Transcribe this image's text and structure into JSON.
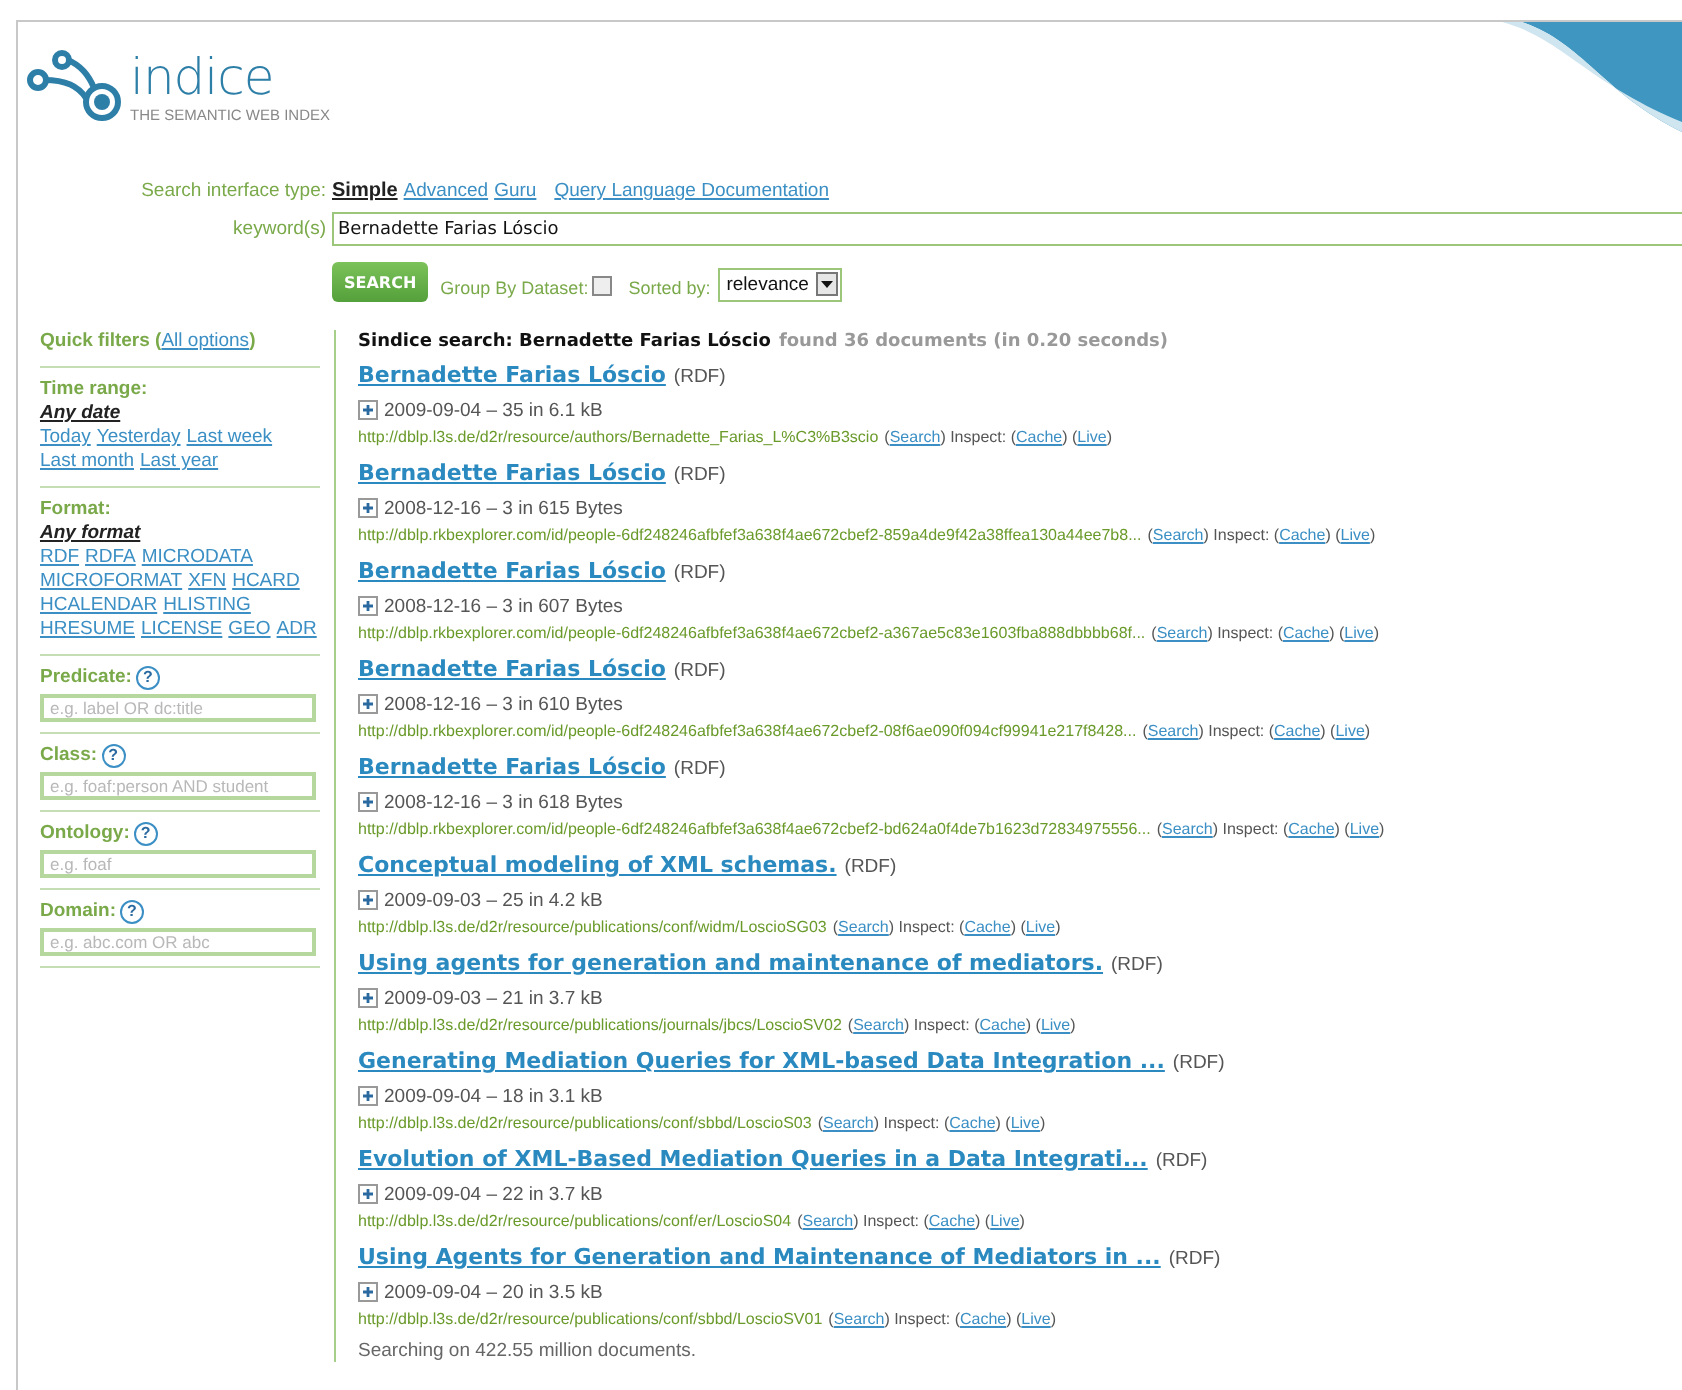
{
  "logo": {
    "name": "indice",
    "tagline": "THE SEMANTIC WEB INDEX"
  },
  "search": {
    "type_label": "Search interface type:",
    "types": [
      {
        "label": "Simple",
        "selected": true
      },
      {
        "label": "Advanced",
        "selected": false
      },
      {
        "label": "Guru",
        "selected": false
      }
    ],
    "doc_link": "Query Language Documentation",
    "keyword_label": "keyword(s)",
    "keyword": "Bernadette Farias Lóscio",
    "button": "SEARCH",
    "group_label": "Group By Dataset:",
    "group_checked": false,
    "sorted_label": "Sorted by:",
    "sort_value": "relevance"
  },
  "sidebar": {
    "title": "Quick filters (",
    "all_options": "All options",
    "title_end": ")",
    "option_groups": [
      {
        "label": "Time range:",
        "options": [
          {
            "label": "Any date",
            "selected": true
          },
          {
            "label": "Today",
            "selected": false
          },
          {
            "label": "Yesterday",
            "selected": false
          },
          {
            "label": "Last week",
            "selected": false
          },
          {
            "label": "Last month",
            "selected": false
          },
          {
            "label": "Last year",
            "selected": false
          }
        ]
      },
      {
        "label": "Format:",
        "options": [
          {
            "label": "Any format",
            "selected": true
          },
          {
            "label": "RDF",
            "selected": false
          },
          {
            "label": "RDFA",
            "selected": false
          },
          {
            "label": "MICRODATA",
            "selected": false
          },
          {
            "label": "MICROFORMAT",
            "selected": false
          },
          {
            "label": "XFN",
            "selected": false
          },
          {
            "label": "HCARD",
            "selected": false
          },
          {
            "label": "HCALENDAR",
            "selected": false
          },
          {
            "label": "HLISTING",
            "selected": false
          },
          {
            "label": "HRESUME",
            "selected": false
          },
          {
            "label": "LICENSE",
            "selected": false
          },
          {
            "label": "GEO",
            "selected": false
          },
          {
            "label": "ADR",
            "selected": false
          }
        ]
      }
    ],
    "fields": [
      {
        "label": "Predicate:",
        "help": "?",
        "placeholder": "e.g. label OR dc:title"
      },
      {
        "label": "Class:",
        "help": "?",
        "placeholder": "e.g. foaf:person AND student"
      },
      {
        "label": "Ontology:",
        "help": "?",
        "placeholder": "e.g. foaf"
      },
      {
        "label": "Domain:",
        "help": "?",
        "placeholder": "e.g. abc.com OR abc"
      }
    ]
  },
  "summary": {
    "query": "Sindice search: Bernadette Farias Lóscio",
    "found": "found 36 documents (in 0.20 seconds)"
  },
  "results": [
    {
      "title": "Bernadette Farias Lóscio",
      "format": "(RDF)",
      "meta": "2009-09-04 – 35 in 6.1 kB",
      "url": "http://dblp.l3s.de/d2r/resource/authors/Bernadette_Farias_L%C3%B3scio",
      "parts": [
        {
          "kind": "text",
          "text": "("
        },
        {
          "kind": "link",
          "text": "Search"
        },
        {
          "kind": "text",
          "text": ") Inspect: ("
        },
        {
          "kind": "link",
          "text": "Cache"
        },
        {
          "kind": "text",
          "text": ") ("
        },
        {
          "kind": "link",
          "text": "Live"
        },
        {
          "kind": "text",
          "text": ")"
        }
      ]
    },
    {
      "title": "Bernadette Farias Lóscio",
      "format": "(RDF)",
      "meta": "2008-12-16 – 3 in 615 Bytes",
      "url": "http://dblp.rkbexplorer.com/id/people-6df248246afbfef3a638f4ae672cbef2-859a4de9f42a38ffea130a44ee7b8...",
      "parts": [
        {
          "kind": "text",
          "text": "("
        },
        {
          "kind": "link",
          "text": "Search"
        },
        {
          "kind": "text",
          "text": ") Inspect: ("
        },
        {
          "kind": "link",
          "text": "Cache"
        },
        {
          "kind": "text",
          "text": ") ("
        },
        {
          "kind": "link",
          "text": "Live"
        },
        {
          "kind": "text",
          "text": ")"
        }
      ]
    },
    {
      "title": "Bernadette Farias Lóscio",
      "format": "(RDF)",
      "meta": "2008-12-16 – 3 in 607 Bytes",
      "url": "http://dblp.rkbexplorer.com/id/people-6df248246afbfef3a638f4ae672cbef2-a367ae5c83e1603fba888dbbbb68f...",
      "parts": [
        {
          "kind": "text",
          "text": "("
        },
        {
          "kind": "link",
          "text": "Search"
        },
        {
          "kind": "text",
          "text": ") Inspect: ("
        },
        {
          "kind": "link",
          "text": "Cache"
        },
        {
          "kind": "text",
          "text": ") ("
        },
        {
          "kind": "link",
          "text": "Live"
        },
        {
          "kind": "text",
          "text": ")"
        }
      ]
    },
    {
      "title": "Bernadette Farias Lóscio",
      "format": "(RDF)",
      "meta": "2008-12-16 – 3 in 610 Bytes",
      "url": "http://dblp.rkbexplorer.com/id/people-6df248246afbfef3a638f4ae672cbef2-08f6ae090f094cf99941e217f8428...",
      "parts": [
        {
          "kind": "text",
          "text": "("
        },
        {
          "kind": "link",
          "text": "Search"
        },
        {
          "kind": "text",
          "text": ") Inspect: ("
        },
        {
          "kind": "link",
          "text": "Cache"
        },
        {
          "kind": "text",
          "text": ") ("
        },
        {
          "kind": "link",
          "text": "Live"
        },
        {
          "kind": "text",
          "text": ")"
        }
      ]
    },
    {
      "title": "Bernadette Farias Lóscio",
      "format": "(RDF)",
      "meta": "2008-12-16 – 3 in 618 Bytes",
      "url": "http://dblp.rkbexplorer.com/id/people-6df248246afbfef3a638f4ae672cbef2-bd624a0f4de7b1623d72834975556...",
      "parts": [
        {
          "kind": "text",
          "text": "("
        },
        {
          "kind": "link",
          "text": "Search"
        },
        {
          "kind": "text",
          "text": ") Inspect: ("
        },
        {
          "kind": "link",
          "text": "Cache"
        },
        {
          "kind": "text",
          "text": ") ("
        },
        {
          "kind": "link",
          "text": "Live"
        },
        {
          "kind": "text",
          "text": ")"
        }
      ]
    },
    {
      "title": "Conceptual modeling of XML schemas.",
      "format": "(RDF)",
      "meta": "2009-09-03 – 25 in 4.2 kB",
      "url": "http://dblp.l3s.de/d2r/resource/publications/conf/widm/LoscioSG03",
      "parts": [
        {
          "kind": "text",
          "text": "("
        },
        {
          "kind": "link",
          "text": "Search"
        },
        {
          "kind": "text",
          "text": ") Inspect: ("
        },
        {
          "kind": "link",
          "text": "Cache"
        },
        {
          "kind": "text",
          "text": ") ("
        },
        {
          "kind": "link",
          "text": "Live"
        },
        {
          "kind": "text",
          "text": ")"
        }
      ]
    },
    {
      "title": "Using agents for generation and maintenance of mediators.",
      "format": "(RDF)",
      "meta": "2009-09-03 – 21 in 3.7 kB",
      "url": "http://dblp.l3s.de/d2r/resource/publications/journals/jbcs/LoscioSV02",
      "parts": [
        {
          "kind": "text",
          "text": "("
        },
        {
          "kind": "link",
          "text": "Search"
        },
        {
          "kind": "text",
          "text": ") Inspect: ("
        },
        {
          "kind": "link",
          "text": "Cache"
        },
        {
          "kind": "text",
          "text": ") ("
        },
        {
          "kind": "link",
          "text": "Live"
        },
        {
          "kind": "text",
          "text": ")"
        }
      ]
    },
    {
      "title": "Generating Mediation Queries for XML-based Data Integration ...",
      "format": "(RDF)",
      "meta": "2009-09-04 – 18 in 3.1 kB",
      "url": "http://dblp.l3s.de/d2r/resource/publications/conf/sbbd/LoscioS03",
      "parts": [
        {
          "kind": "text",
          "text": "("
        },
        {
          "kind": "link",
          "text": "Search"
        },
        {
          "kind": "text",
          "text": ") Inspect: ("
        },
        {
          "kind": "link",
          "text": "Cache"
        },
        {
          "kind": "text",
          "text": ") ("
        },
        {
          "kind": "link",
          "text": "Live"
        },
        {
          "kind": "text",
          "text": ")"
        }
      ]
    },
    {
      "title": "Evolution of XML-Based Mediation Queries in a Data Integrati...",
      "format": "(RDF)",
      "meta": "2009-09-04 – 22 in 3.7 kB",
      "url": "http://dblp.l3s.de/d2r/resource/publications/conf/er/LoscioS04",
      "parts": [
        {
          "kind": "text",
          "text": "("
        },
        {
          "kind": "link",
          "text": "Search"
        },
        {
          "kind": "text",
          "text": ") Inspect: ("
        },
        {
          "kind": "link",
          "text": "Cache"
        },
        {
          "kind": "text",
          "text": ") ("
        },
        {
          "kind": "link",
          "text": "Live"
        },
        {
          "kind": "text",
          "text": ")"
        }
      ]
    },
    {
      "title": "Using Agents for Generation and Maintenance of Mediators in ...",
      "format": "(RDF)",
      "meta": "2009-09-04 – 20 in 3.5 kB",
      "url": "http://dblp.l3s.de/d2r/resource/publications/conf/sbbd/LoscioSV01",
      "parts": [
        {
          "kind": "text",
          "text": "("
        },
        {
          "kind": "link",
          "text": "Search"
        },
        {
          "kind": "text",
          "text": ") Inspect: ("
        },
        {
          "kind": "link",
          "text": "Cache"
        },
        {
          "kind": "text",
          "text": ") ("
        },
        {
          "kind": "link",
          "text": "Live"
        },
        {
          "kind": "text",
          "text": ")"
        }
      ]
    }
  ],
  "footer": "Searching on 422.55 million documents."
}
